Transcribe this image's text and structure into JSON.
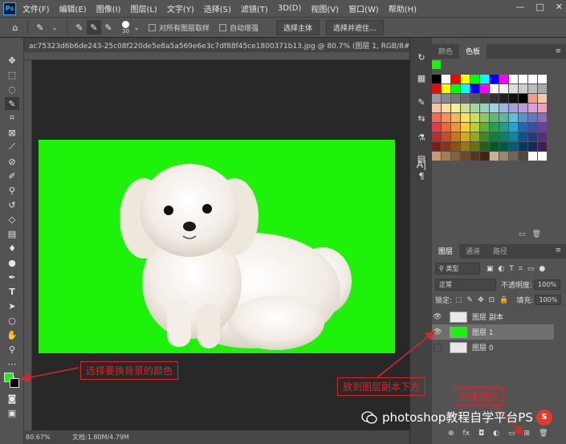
{
  "app": {
    "logo": "Ps"
  },
  "menu": [
    "文件(F)",
    "编辑(E)",
    "图像(I)",
    "图层(L)",
    "文字(Y)",
    "选择(S)",
    "滤镜(T)",
    "3D(D)",
    "视图(V)",
    "窗口(W)",
    "帮助(H)"
  ],
  "window_controls": {
    "minimize": "—",
    "maximize": "□",
    "close": "✕"
  },
  "options": {
    "brush_size": "30",
    "sample_all_layers": "对所有图层取样",
    "auto_enhance": "自动增强",
    "select_subject": "选择主体",
    "select_and_mask": "选择并遮住..."
  },
  "document": {
    "tab_title": "ac75323d6b6de243-25c08f220de5e8a5a569e6e3c7df88f45ce1800371b13.jpg @ 80.7% (图层 1, RGB/8#) *",
    "close": "×"
  },
  "status": {
    "zoom": "80.67%",
    "doc_size": "文档:1.80M/4.79M"
  },
  "color_panel": {
    "tabs": [
      "颜色",
      "色板"
    ],
    "active_tab": "色板"
  },
  "swatches": [
    "#000000",
    "#ffffff",
    "#ff0000",
    "#ffff00",
    "#00ff00",
    "#00ffff",
    "#0000ff",
    "#ff00ff",
    "#ffffff",
    "#ffffff",
    "#ffffff",
    "#ffffff",
    "#ff0000",
    "#ffff00",
    "#00ff00",
    "#00ffff",
    "#0000ff",
    "#ff00ff",
    "#ffffff",
    "#eeeeee",
    "#dddddd",
    "#cccccc",
    "#bbbbbb",
    "#aaaaaa",
    "#999999",
    "#888888",
    "#777777",
    "#666666",
    "#555555",
    "#444444",
    "#333333",
    "#222222",
    "#111111",
    "#000000",
    "#f0a08a",
    "#f5c9a8",
    "#f7c2a1",
    "#f7e09d",
    "#f2f29b",
    "#c8e29a",
    "#a2d6a2",
    "#98d0b9",
    "#9bd3e0",
    "#9cb7dc",
    "#a3a1d6",
    "#b99ad2",
    "#d9a1cf",
    "#eca0be",
    "#ee6a57",
    "#f29457",
    "#f5b659",
    "#f5e45c",
    "#cce05e",
    "#8cc863",
    "#5fb971",
    "#5cb6a1",
    "#5cc0d8",
    "#5c90cd",
    "#6679c0",
    "#8f6cb6",
    "#e8394a",
    "#ec6a31",
    "#f09430",
    "#f5cf2e",
    "#b7d12a",
    "#5cb035",
    "#21a549",
    "#1ea088",
    "#1fa7cf",
    "#2064b3",
    "#3a4ea2",
    "#6e3e9d",
    "#b42f2b",
    "#c24f25",
    "#c97422",
    "#d2aa1c",
    "#92a81f",
    "#3d8a2b",
    "#0f823a",
    "#0d7f6b",
    "#0e85a6",
    "#10508e",
    "#263a82",
    "#552f7c",
    "#7b1f1b",
    "#863616",
    "#8d5114",
    "#947810",
    "#657516",
    "#275f1e",
    "#065a26",
    "#065849",
    "#075c73",
    "#073763",
    "#18275a",
    "#3b2056",
    "#c49b72",
    "#a27b57",
    "#85603f",
    "#6a4a2d",
    "#533720",
    "#3e2612",
    "#c7b299",
    "#998675",
    "#736357",
    "#534741",
    "#ffffff",
    "#ffffff"
  ],
  "layers_panel": {
    "tabs": [
      "图层",
      "通道",
      "路径"
    ],
    "active_tab": "图层",
    "filter_label": "类型",
    "blend_mode": "正常",
    "opacity_label": "不透明度:",
    "opacity": "100%",
    "lock_label": "锁定:",
    "fill_label": "填充:",
    "fill": "100%",
    "layers": [
      {
        "name": "图层 副本",
        "visible": true,
        "selected": false,
        "thumb": "#e8e8e8"
      },
      {
        "name": "图层 1",
        "visible": true,
        "selected": true,
        "thumb": "#1ef20a"
      },
      {
        "name": "图层 0",
        "visible": false,
        "selected": false,
        "thumb": "#e8e8e8"
      }
    ],
    "footer_icons": [
      "⊕",
      "fx",
      "◘",
      "◐",
      "▭",
      "⊞",
      "🗑"
    ]
  },
  "annotations": {
    "choose_color": "选择要换背景的颜色",
    "below_copy": "放到图层副本下方",
    "new_layer": "新建图层"
  },
  "watermark": {
    "text": "photoshop教程自学平台PS",
    "badge": "S"
  },
  "colors": {
    "green": "#1ef20a",
    "annotation_red": "#d52a2a",
    "panel_bg": "#535353",
    "canvas_bg": "#282828"
  }
}
